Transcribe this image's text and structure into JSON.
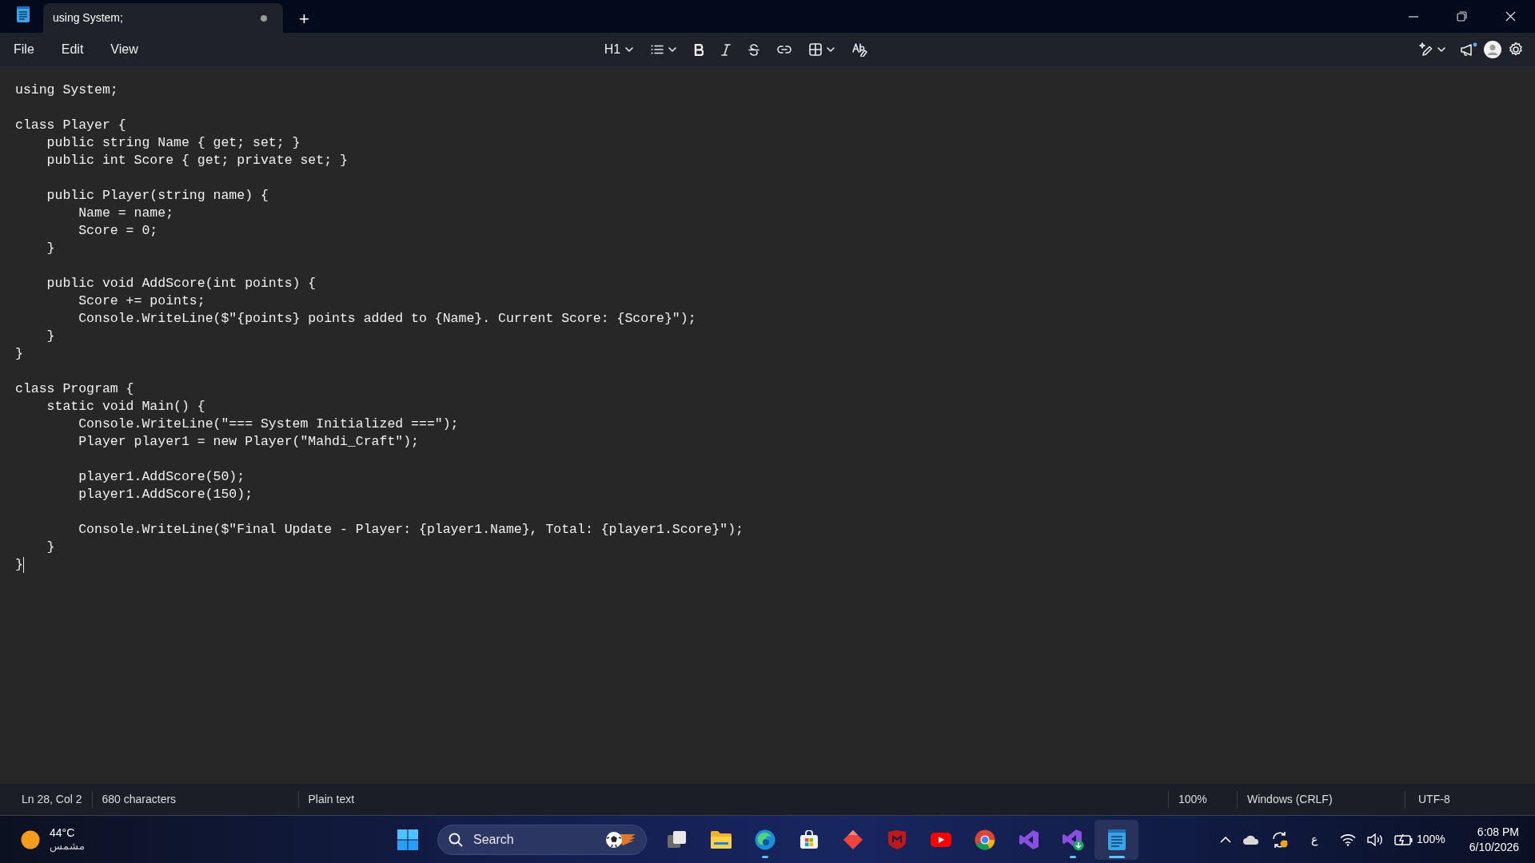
{
  "window": {
    "tabs": [
      {
        "title": "using System;",
        "unsaved": true,
        "selected": true
      }
    ],
    "new_tab": "+"
  },
  "menu": [
    "File",
    "Edit",
    "View"
  ],
  "toolbar": {
    "heading": "H1"
  },
  "editor": {
    "blocks": [
      [
        "using System;"
      ],
      [
        "class Player {",
        "    public string Name { get; set; }",
        "    public int Score { get; private set; }"
      ],
      [
        "    public Player(string name) {",
        "        Name = name;",
        "        Score = 0;",
        "    }"
      ],
      [
        "    public void AddScore(int points) {",
        "        Score += points;",
        "        Console.WriteLine($\"{points} points added to {Name}. Current Score: {Score}\");",
        "    }",
        "}"
      ],
      [
        "class Program {",
        "    static void Main() {",
        "        Console.WriteLine(\"=== System Initialized ===\");",
        "        Player player1 = new Player(\"Mahdi_Craft\");"
      ],
      [
        "        player1.AddScore(50);",
        "        player1.AddScore(150);"
      ],
      [
        "        Console.WriteLine($\"Final Update - Player: {player1.Name}, Total: {player1.Score}\");",
        "    }",
        "}"
      ]
    ],
    "caret": true
  },
  "status_bar": {
    "position": "Ln 28, Col 2",
    "count": "680 characters",
    "format": "Plain text",
    "zoom": "100%",
    "line_endings": "Windows (CRLF)",
    "encoding": "UTF-8"
  },
  "taskbar": {
    "weather": {
      "temperature": "44°C",
      "condition": "مشمس"
    },
    "search": {
      "placeholder": "Search"
    },
    "apps": [
      {
        "kind": "start",
        "running": false,
        "active": false
      },
      {
        "kind": "taskview",
        "running": false,
        "active": false
      },
      {
        "kind": "explorer",
        "running": false,
        "active": false
      },
      {
        "kind": "edge",
        "running": true,
        "active": false
      },
      {
        "kind": "store",
        "running": false,
        "active": false
      },
      {
        "kind": "diamond",
        "running": false,
        "active": false
      },
      {
        "kind": "shield",
        "running": false,
        "active": false
      },
      {
        "kind": "youtube",
        "running": false,
        "active": false
      },
      {
        "kind": "chrome",
        "running": false,
        "active": false
      },
      {
        "kind": "studio",
        "running": false,
        "active": false
      },
      {
        "kind": "installer",
        "running": true,
        "active": false
      },
      {
        "kind": "notepad",
        "running": true,
        "active": true
      }
    ],
    "input_language": "ع",
    "battery": "100%",
    "time": "6:08 PM",
    "date": "6/10/2026"
  }
}
